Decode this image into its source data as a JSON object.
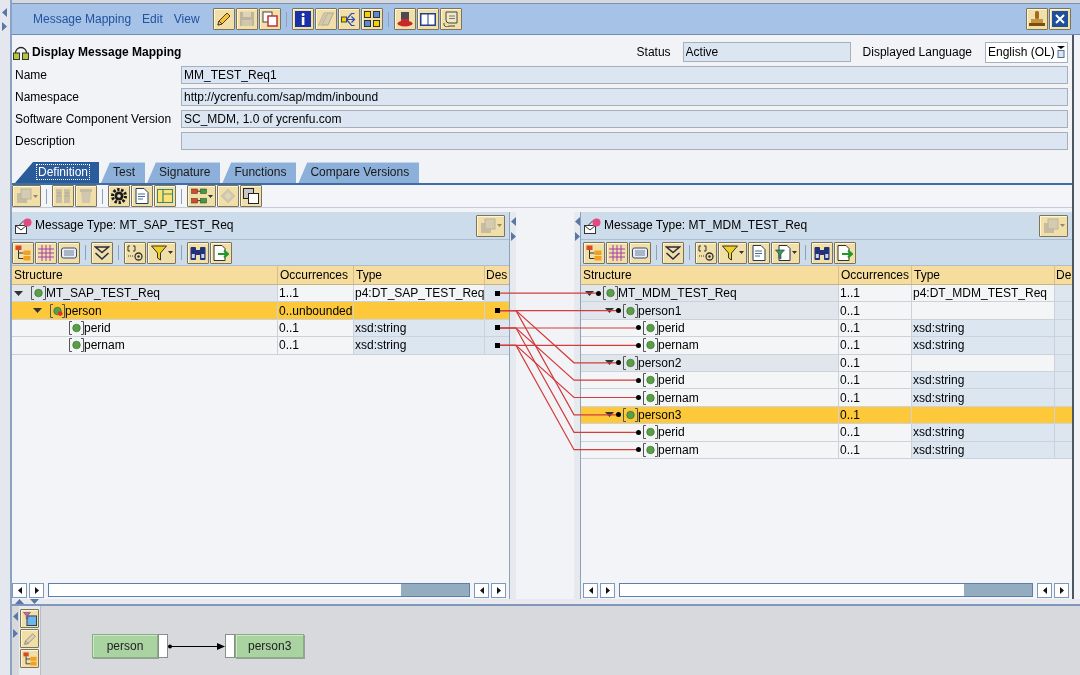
{
  "menu": [
    "Message Mapping",
    "Edit",
    "View"
  ],
  "menu_toolbar": [
    {
      "disabled": false
    },
    {
      "disabled": true
    },
    {
      "disabled": false
    },
    {
      "disabled": false
    },
    {
      "disabled": true
    },
    {
      "disabled": false
    },
    {
      "disabled": false
    },
    {
      "disabled": false
    },
    {
      "disabled": false
    },
    {
      "disabled": false
    }
  ],
  "header": {
    "title": "Display Message Mapping",
    "status": {
      "label": "Status",
      "value": "Active"
    },
    "language": {
      "label": "Displayed Language",
      "value": "English (OL)"
    },
    "fields": [
      {
        "label": "Name",
        "value": "MM_TEST_Req1"
      },
      {
        "label": "Namespace",
        "value": "http://ycrenfu.com/sap/mdm/inbound"
      },
      {
        "label": "Software Component Version",
        "value": "SC_MDM, 1.0 of ycrenfu.com"
      },
      {
        "label": "Description"
      }
    ]
  },
  "tabs": [
    {
      "label": "Definition",
      "selected": true
    },
    {
      "label": "Test",
      "selected": false
    },
    {
      "label": "Signature",
      "selected": false
    },
    {
      "label": "Functions",
      "selected": false
    },
    {
      "label": "Compare Versions",
      "selected": false
    }
  ],
  "toolbar": [
    {
      "disabled": true
    },
    {
      "disabled": true
    },
    {
      "disabled": true
    },
    {
      "disabled": false
    },
    {
      "disabled": false
    },
    {
      "disabled": false
    },
    {
      "disabled": false
    },
    {
      "disabled": true
    },
    {
      "disabled": false
    }
  ],
  "left_pane": {
    "title": "Message Type: MT_SAP_TEST_Req",
    "options_button": {
      "disabled": true
    },
    "columns": [
      "Structure",
      "Occurrences",
      "Type",
      "Des"
    ],
    "tree": [
      {
        "name": "MT_SAP_TEST_Req",
        "occurrences": "1..1",
        "type": "p4:DT_SAP_TEST_Req",
        "expanded": true,
        "selected": false,
        "mapped": true,
        "flagged": false,
        "children": [
          {
            "name": "person",
            "occurrences": "0..unbounded",
            "expanded": true,
            "selected": true,
            "mapped": true,
            "flagged": true,
            "children": [
              {
                "name": "perid",
                "occurrences": "0..1",
                "type": "xsd:string",
                "selected": false,
                "mapped": true,
                "flagged": false
              },
              {
                "name": "pernam",
                "occurrences": "0..1",
                "type": "xsd:string",
                "selected": false,
                "mapped": true,
                "flagged": false
              }
            ]
          }
        ]
      }
    ]
  },
  "right_pane": {
    "title": "Message Type: MT_MDM_TEST_Req",
    "options_button": {
      "disabled": true
    },
    "columns": [
      "Structure",
      "Occurrences",
      "Type",
      "De"
    ],
    "tree": [
      {
        "name": "MT_MDM_TEST_Req",
        "occurrences": "1..1",
        "type": "p4:DT_MDM_TEST_Req",
        "expanded": true,
        "selected": false,
        "mapped": true,
        "children": [
          {
            "name": "person1",
            "occurrences": "0..1",
            "expanded": true,
            "selected": false,
            "mapped": true,
            "children": [
              {
                "name": "perid",
                "occurrences": "0..1",
                "type": "xsd:string",
                "selected": false,
                "mapped": true
              },
              {
                "name": "pernam",
                "occurrences": "0..1",
                "type": "xsd:string",
                "selected": false,
                "mapped": true
              }
            ]
          },
          {
            "name": "person2",
            "occurrences": "0..1",
            "expanded": true,
            "selected": false,
            "mapped": true,
            "children": [
              {
                "name": "perid",
                "occurrences": "0..1",
                "type": "xsd:string",
                "selected": false,
                "mapped": true
              },
              {
                "name": "pernam",
                "occurrences": "0..1",
                "type": "xsd:string",
                "selected": false,
                "mapped": true
              }
            ]
          },
          {
            "name": "person3",
            "occurrences": "0..1",
            "expanded": true,
            "selected": true,
            "mapped": true,
            "children": [
              {
                "name": "perid",
                "occurrences": "0..1",
                "type": "xsd:string",
                "selected": false,
                "mapped": true
              },
              {
                "name": "pernam",
                "occurrences": "0..1",
                "type": "xsd:string",
                "selected": false,
                "mapped": true
              }
            ]
          }
        ]
      }
    ]
  },
  "side_toolbar": [
    {
      "disabled": false
    },
    {
      "disabled": true
    },
    {
      "disabled": false
    }
  ],
  "mapping_graph": {
    "nodes": [
      {
        "label": "person"
      },
      {
        "label": "person3"
      }
    ]
  }
}
